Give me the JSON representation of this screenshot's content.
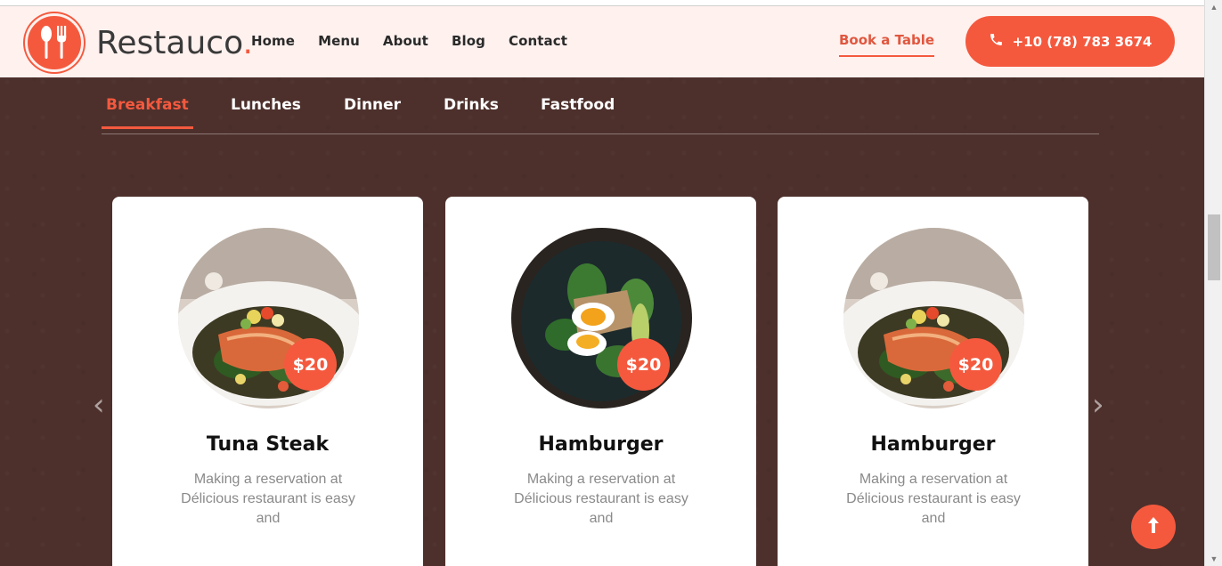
{
  "brand": {
    "name": "Restauco",
    "dot": "."
  },
  "nav": {
    "items": [
      "Home",
      "Menu",
      "About",
      "Blog",
      "Contact"
    ]
  },
  "header": {
    "book_label": "Book a Table",
    "phone": "+10 (78) 783 3674"
  },
  "tabs": [
    "Breakfast",
    "Lunches",
    "Dinner",
    "Drinks",
    "Fastfood"
  ],
  "active_tab": "Breakfast",
  "cards": [
    {
      "price": "$20",
      "title": "Tuna Steak",
      "desc": "Making a reservation at Délicious restaurant is easy and",
      "image": "salmon-plate"
    },
    {
      "price": "$20",
      "title": "Hamburger",
      "desc": "Making a reservation at Délicious restaurant is easy and",
      "image": "egg-avocado-plate"
    },
    {
      "price": "$20",
      "title": "Hamburger",
      "desc": "Making a reservation at Délicious restaurant is easy and",
      "image": "salmon-plate"
    }
  ],
  "colors": {
    "accent": "#f4593e",
    "background": "#4d302c",
    "header_bg": "#fff1ee"
  },
  "icons": {
    "logo": "spoon-fork-icon",
    "phone": "phone-icon",
    "prev": "chevron-left-icon",
    "next": "chevron-right-icon",
    "scroll_top": "arrow-up-icon"
  }
}
